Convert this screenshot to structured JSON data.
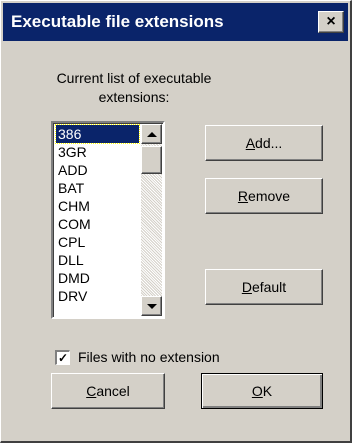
{
  "window": {
    "title": "Executable file extensions",
    "close_label": "×",
    "colors": {
      "titlebar": "#0a246a",
      "face": "#d4d0c8"
    }
  },
  "list_label_line1": "Current list of executable",
  "list_label_line2": "extensions:",
  "extensions": [
    "386",
    "3GR",
    "ADD",
    "BAT",
    "CHM",
    "COM",
    "CPL",
    "DLL",
    "DMD",
    "DRV"
  ],
  "selected_extension": "386",
  "buttons": {
    "add_key": "A",
    "add_rest": "dd...",
    "remove_key": "R",
    "remove_rest": "emove",
    "default_key": "D",
    "default_rest": "efault",
    "cancel_key": "C",
    "cancel_rest": "ancel",
    "ok_key": "O",
    "ok_rest": "K"
  },
  "checkbox": {
    "label": "Files with no extension",
    "checked": true,
    "check_mark": "✓"
  },
  "icons": {
    "close": "close-icon",
    "scroll_up": "arrow-up-icon",
    "scroll_down": "arrow-down-icon",
    "check": "checkmark-icon"
  }
}
